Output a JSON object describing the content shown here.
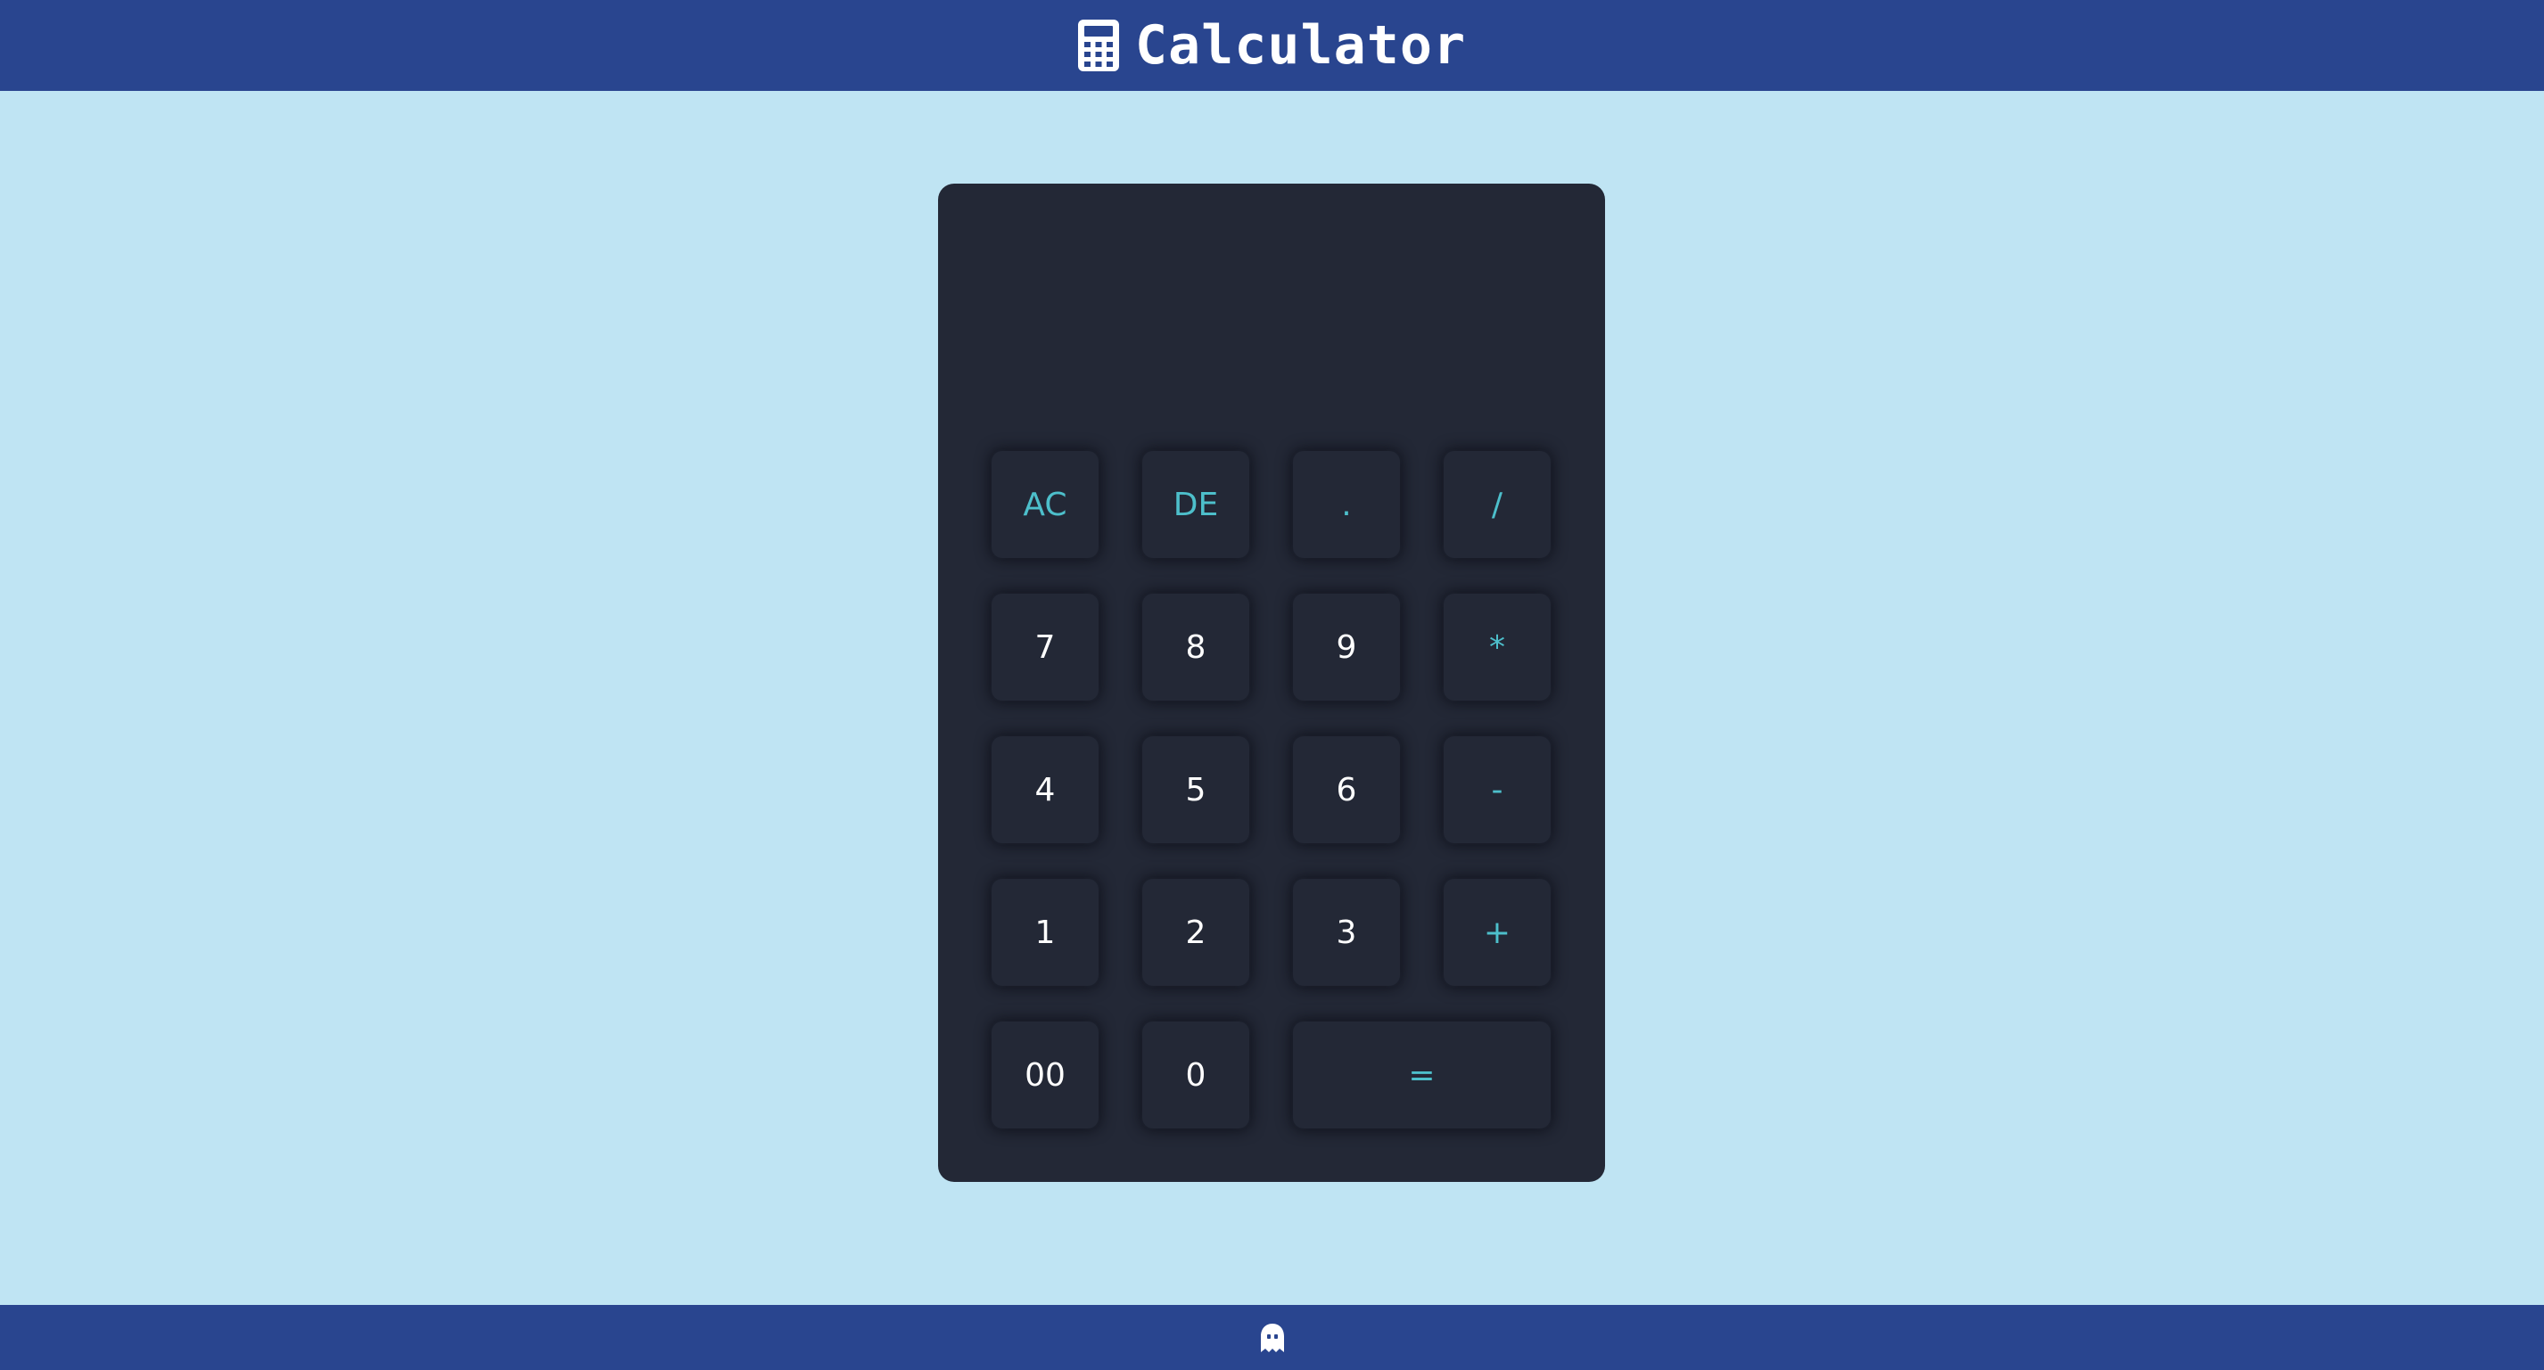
{
  "header": {
    "title": "Calculator",
    "icon": "calculator-icon"
  },
  "calculator": {
    "display_value": "",
    "keys": [
      {
        "label": "AC",
        "type": "op"
      },
      {
        "label": "DE",
        "type": "op"
      },
      {
        "label": ".",
        "type": "op"
      },
      {
        "label": "/",
        "type": "op"
      },
      {
        "label": "7",
        "type": "num"
      },
      {
        "label": "8",
        "type": "num"
      },
      {
        "label": "9",
        "type": "num"
      },
      {
        "label": "*",
        "type": "op"
      },
      {
        "label": "4",
        "type": "num"
      },
      {
        "label": "5",
        "type": "num"
      },
      {
        "label": "6",
        "type": "num"
      },
      {
        "label": "-",
        "type": "op"
      },
      {
        "label": "1",
        "type": "num"
      },
      {
        "label": "2",
        "type": "num"
      },
      {
        "label": "3",
        "type": "num"
      },
      {
        "label": "+",
        "type": "op"
      },
      {
        "label": "00",
        "type": "num"
      },
      {
        "label": "0",
        "type": "num"
      },
      {
        "label": "=",
        "type": "op"
      }
    ]
  },
  "footer": {
    "icon": "ghost-icon"
  },
  "colors": {
    "background": "#bfe4f3",
    "bar": "#29458f",
    "calculator_body": "#232836",
    "accent": "#4dbfcb",
    "digit_text": "#ffffff"
  }
}
